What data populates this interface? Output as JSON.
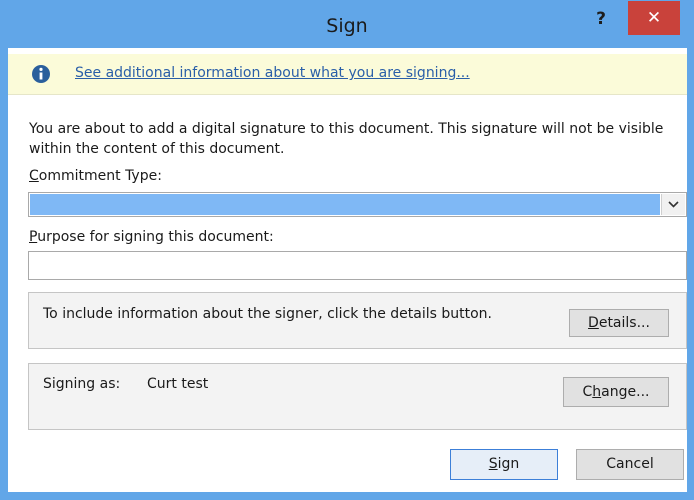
{
  "window": {
    "title": "Sign",
    "help_label": "?",
    "close_label": "✕",
    "accent_color": "#61a6e8",
    "close_color": "#c9423b"
  },
  "infobar": {
    "icon": "info-icon",
    "link_text": "See additional information about what you are signing..."
  },
  "description": "You are about to add a digital signature to this document. This signature will not be visible within the content of this document.",
  "commitment": {
    "label_mnemonic": "C",
    "label_rest": "ommitment Type:",
    "selected_value": "",
    "arrow_icon": "chevron-down-icon"
  },
  "purpose": {
    "label_mnemonic": "P",
    "label_rest": "urpose for signing this document:",
    "value": ""
  },
  "signer_details": {
    "text": "To include information about the signer, click the details button.",
    "button_mnemonic": "D",
    "button_rest": "etails..."
  },
  "signing_as": {
    "label": "Signing as:",
    "name": "Curt test",
    "button_pre": "C",
    "button_mnemonic": "h",
    "button_post": "ange..."
  },
  "actions": {
    "sign_mnemonic": "S",
    "sign_rest": "ign",
    "cancel_label": "Cancel"
  }
}
